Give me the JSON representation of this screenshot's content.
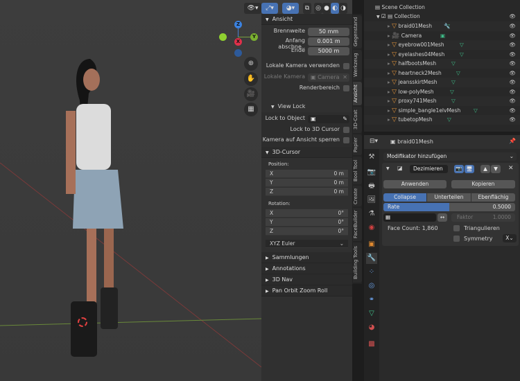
{
  "viewport": {
    "header_icons": [
      "view-icon",
      "select-icon",
      "overlay-icon",
      "xray-icon",
      "wireframe-icon",
      "solid-icon",
      "material-icon",
      "rendered-icon"
    ],
    "gizmo": {
      "z": "Z",
      "y": "Y",
      "x": "X"
    },
    "nav": [
      "zoom-icon",
      "hand-icon",
      "camera-icon",
      "grid-icon"
    ]
  },
  "npanel": {
    "ansicht": {
      "title": "Ansicht",
      "brennweite_label": "Brennweite",
      "brennweite": "50 mm",
      "anfang_label": "Anfang abschne..",
      "anfang": "0.001 m",
      "ende_label": "Ende",
      "ende": "5000 m",
      "lokale_kamera_verwenden": "Lokale Kamera verwenden",
      "lokale_kamera_label": "Lokale Kamera",
      "lokale_kamera": "Camera",
      "renderbereich": "Renderbereich"
    },
    "viewlock": {
      "title": "View Lock",
      "lock_object_label": "Lock to Object",
      "lock_cursor": "Lock to 3D Cursor",
      "kamera_sperren": "Kamera auf Ansicht sperren"
    },
    "cursor": {
      "title": "3D-Cursor",
      "position_label": "Position:",
      "position": [
        {
          "axis": "X",
          "value": "0 m"
        },
        {
          "axis": "Y",
          "value": "0 m"
        },
        {
          "axis": "Z",
          "value": "0 m"
        }
      ],
      "rotation_label": "Rotation:",
      "rotation": [
        {
          "axis": "X",
          "value": "0°"
        },
        {
          "axis": "Y",
          "value": "0°"
        },
        {
          "axis": "Z",
          "value": "0°"
        }
      ],
      "mode": "XYZ Euler"
    },
    "collapsed": [
      "Sammlungen",
      "Annotations",
      "3D Nav",
      "Pan Orbit Zoom Roll"
    ]
  },
  "tabs": [
    "Gegenstand",
    "Werkzeug",
    "Ansicht",
    "3D-Coat",
    "Papier",
    "Bool Tool",
    "Create",
    "FaceBuilder",
    "Building Tools"
  ],
  "outliner": {
    "scene": "Scene Collection",
    "collection": "Collection",
    "items": [
      "braid01Mesh",
      "Camera",
      "eyebrow001Mesh",
      "eyelashes04Mesh",
      "halfbootsMesh",
      "heartneck2Mesh",
      "jeansskirtMesh",
      "low-polyMesh",
      "proxy741Mesh",
      "simple_bangle1elvMesh",
      "tubetopMesh"
    ]
  },
  "properties": {
    "object": "braid01Mesh",
    "add_modifier": "Modifikator hinzufügen",
    "modifier_name": "Dezimieren",
    "apply": "Anwenden",
    "copy": "Kopieren",
    "modes": [
      "Collapse",
      "Unterteilen",
      "Ebenflächig"
    ],
    "rate_label": "Rate",
    "rate": "0.5000",
    "rate_fraction": 0.5,
    "faktor_label": "Faktor",
    "faktor": "1.0000",
    "face_count": "Face Count: 1,860",
    "triangulate": "Triangulieren",
    "symmetry": "Symmetry",
    "symmetry_axis": "X"
  }
}
